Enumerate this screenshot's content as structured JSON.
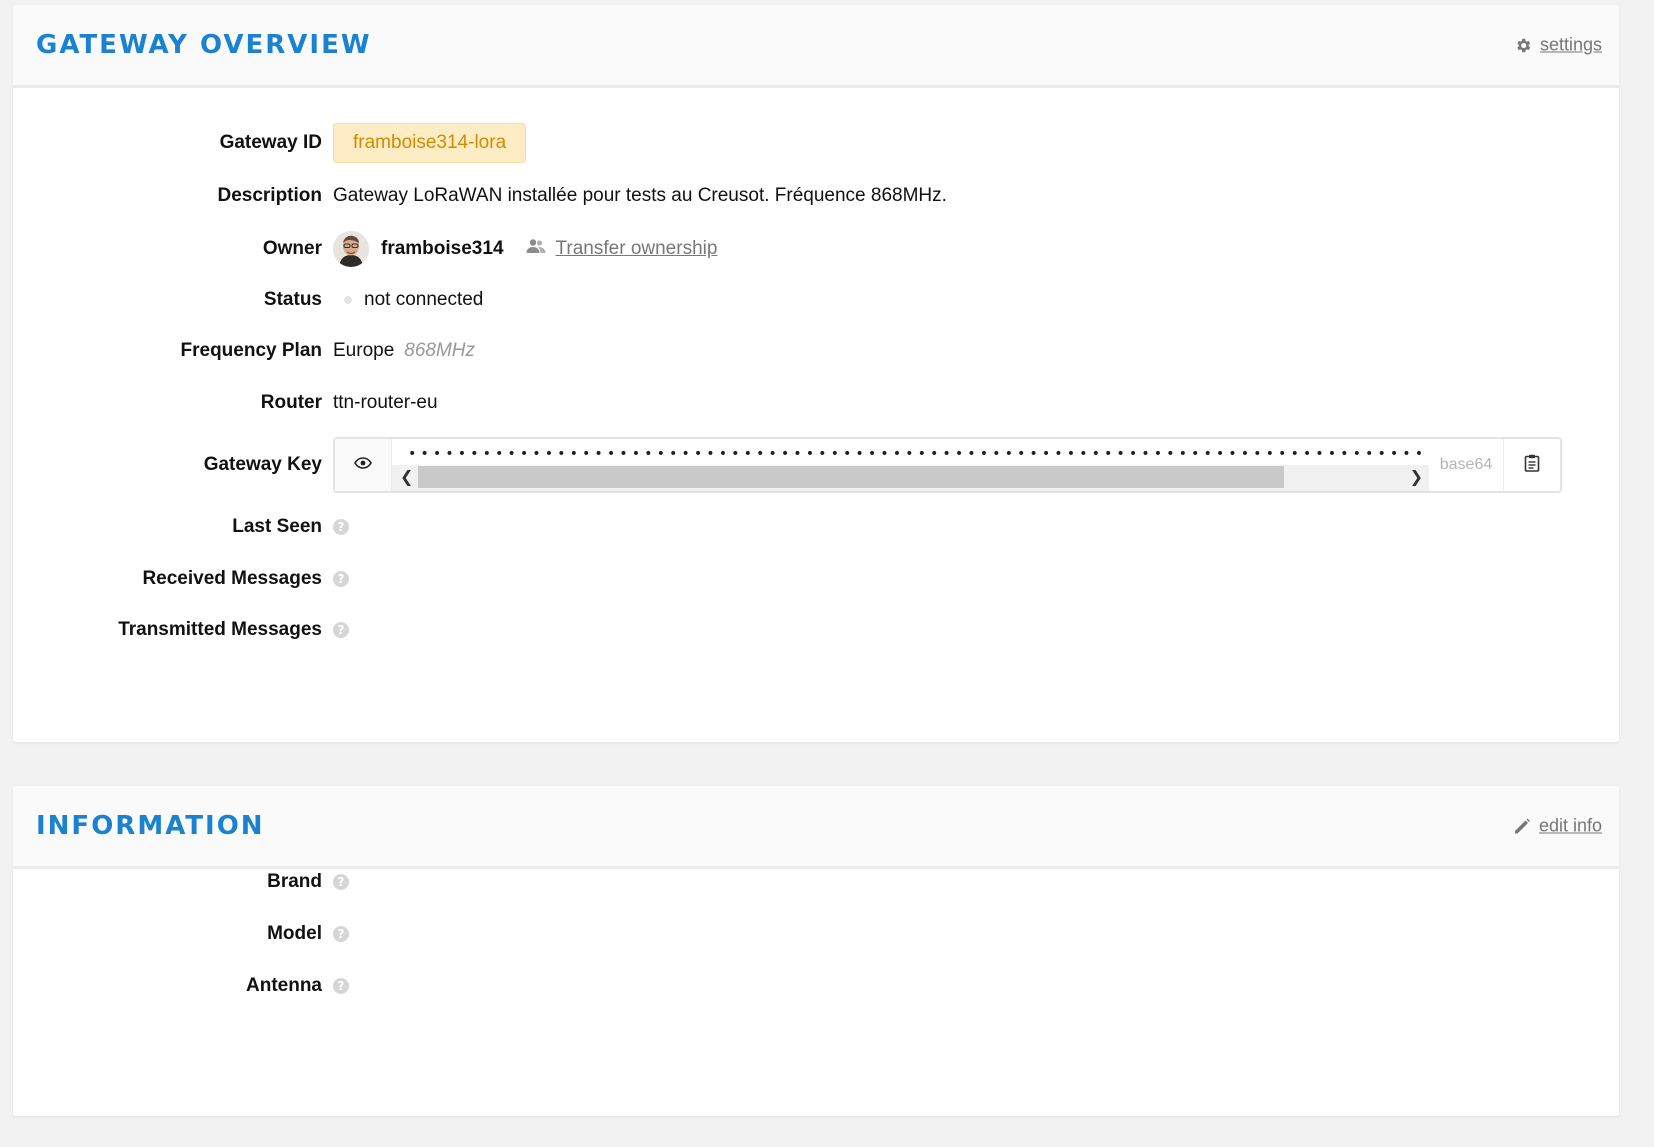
{
  "overview": {
    "title": "GATEWAY OVERVIEW",
    "settings_label": "settings",
    "rows": {
      "gateway_id": {
        "label": "Gateway ID",
        "value": "framboise314-lora"
      },
      "description": {
        "label": "Description",
        "value": "Gateway LoRaWAN installée pour tests au Creusot. Fréquence 868MHz."
      },
      "owner": {
        "label": "Owner",
        "username": "framboise314",
        "transfer_label": "Transfer ownership"
      },
      "status": {
        "label": "Status",
        "value": "not connected"
      },
      "frequency_plan": {
        "label": "Frequency Plan",
        "value": "Europe",
        "sub": "868MHz"
      },
      "router": {
        "label": "Router",
        "value": "ttn-router-eu"
      },
      "gateway_key": {
        "label": "Gateway Key",
        "masked": "••••••••••••••••••••••••••••••••••••••••••••••••••••••••••••••••••••••••••••••••••••••••••••••",
        "format": "base64"
      },
      "last_seen": {
        "label": "Last Seen"
      },
      "received_messages": {
        "label": "Received Messages"
      },
      "transmitted_messages": {
        "label": "Transmitted Messages"
      }
    }
  },
  "information": {
    "title": "INFORMATION",
    "edit_label": "edit info",
    "rows": {
      "brand": {
        "label": "Brand"
      },
      "model": {
        "label": "Model"
      },
      "antenna": {
        "label": "Antenna"
      }
    }
  },
  "help_glyph": "?",
  "colors": {
    "accent": "#1a82cf",
    "badge_bg": "#fdecc4",
    "badge_text": "#d28c00",
    "status_offline": "#e4e4e4"
  },
  "icons": {
    "settings": "gear-icon",
    "transfer": "users-icon",
    "show_key": "eye-icon",
    "copy": "clipboard-icon",
    "edit": "pencil-icon",
    "help": "help-icon"
  }
}
